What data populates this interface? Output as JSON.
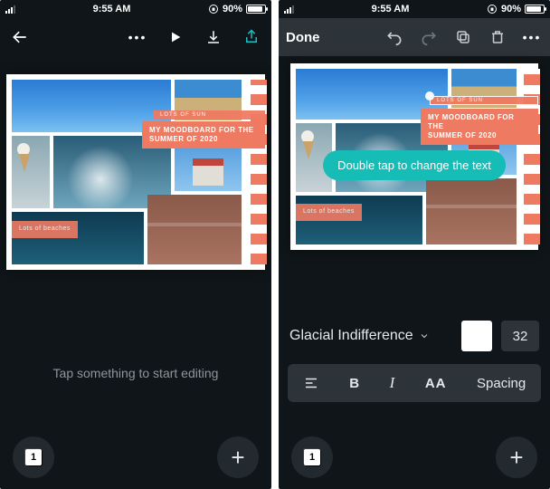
{
  "status": {
    "time": "9:55 AM",
    "battery_pct": "90%"
  },
  "left": {
    "hint": "Tap something to start editing",
    "page_number": "1",
    "moodboard": {
      "subtitle_top": "LOTS OF SUN",
      "title_line1": "MY MOODBOARD FOR THE",
      "title_line2": "SUMMER OF 2020",
      "caption_bottom": "Lots of beaches"
    }
  },
  "right": {
    "done_label": "Done",
    "tooltip": "Double tap to change the text",
    "font_name": "Glacial Indifference",
    "font_size": "32",
    "format": {
      "bold": "B",
      "italic": "I",
      "caps": "AA",
      "spacing": "Spacing"
    },
    "page_number": "1",
    "moodboard": {
      "subtitle_top": "LOTS OF SUN",
      "title_line1": "MY MOODBOARD FOR THE",
      "title_line2": "SUMMER OF 2020",
      "caption_bottom": "Lots of beaches"
    }
  }
}
